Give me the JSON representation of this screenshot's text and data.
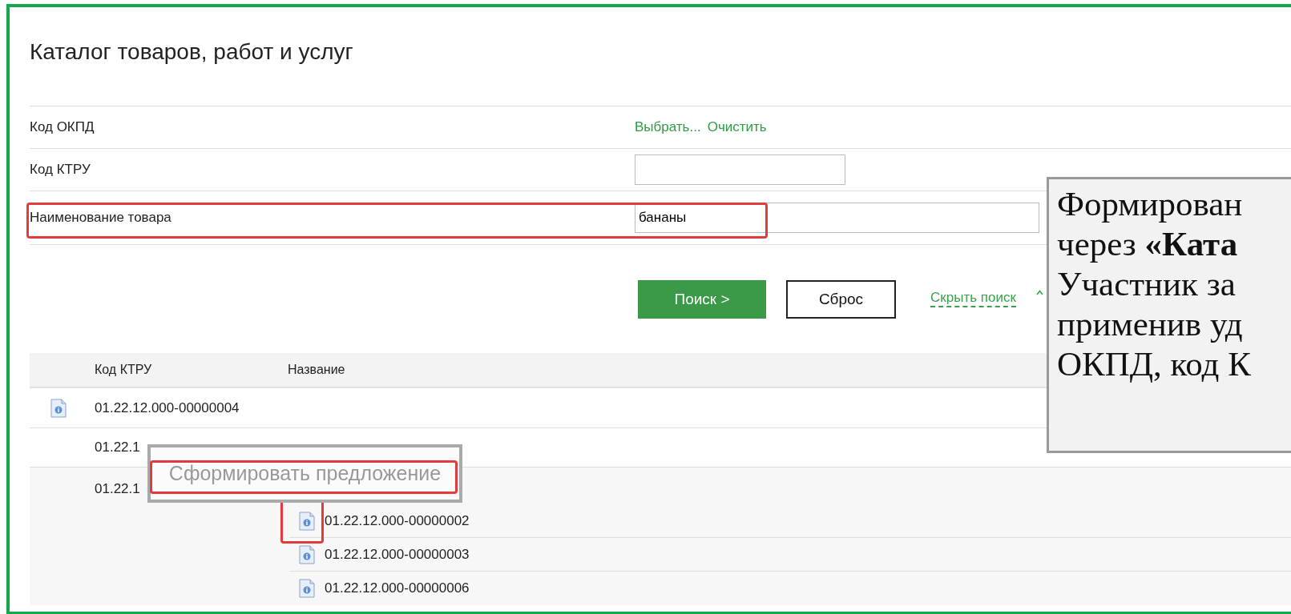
{
  "page_title": "Каталог товаров, работ и услуг",
  "filters": [
    {
      "label": "Код ОКПД",
      "kind": "links",
      "links": [
        "Выбрать...",
        "Очистить"
      ],
      "highlighted": false
    },
    {
      "label": "Код КТРУ",
      "kind": "input",
      "highlighted": false
    },
    {
      "label": "Наименование товара",
      "kind": "input",
      "value": "бананы",
      "highlighted": true
    }
  ],
  "buttons": [
    {
      "label": "Поиск >",
      "kind": "primary"
    },
    {
      "label": "Сброс",
      "kind": "secondary"
    }
  ],
  "toggle_link": "Скрыть поиск",
  "table": {
    "columns": [
      "Код КТРУ",
      "Название"
    ],
    "rows": [
      {
        "kind": "item",
        "code": "01.22.12.000-00000004"
      },
      {
        "kind": "group",
        "code": "01.22.1"
      },
      {
        "kind": "group",
        "code": "01.22.1",
        "children": [
          {
            "code": "01.22.12.000-00000002",
            "highlighted": true
          },
          {
            "code": "01.22.12.000-00000003",
            "highlighted": false
          },
          {
            "code": "01.22.12.000-00000006",
            "highlighted": false
          }
        ]
      }
    ]
  },
  "tooltip": {
    "text": "Сформировать предложение",
    "highlighted": true
  },
  "callout": {
    "lines": [
      "Формирован",
      "через **«Ката**",
      "Участник за",
      "применив уд",
      "ОКПД, код К"
    ]
  }
}
